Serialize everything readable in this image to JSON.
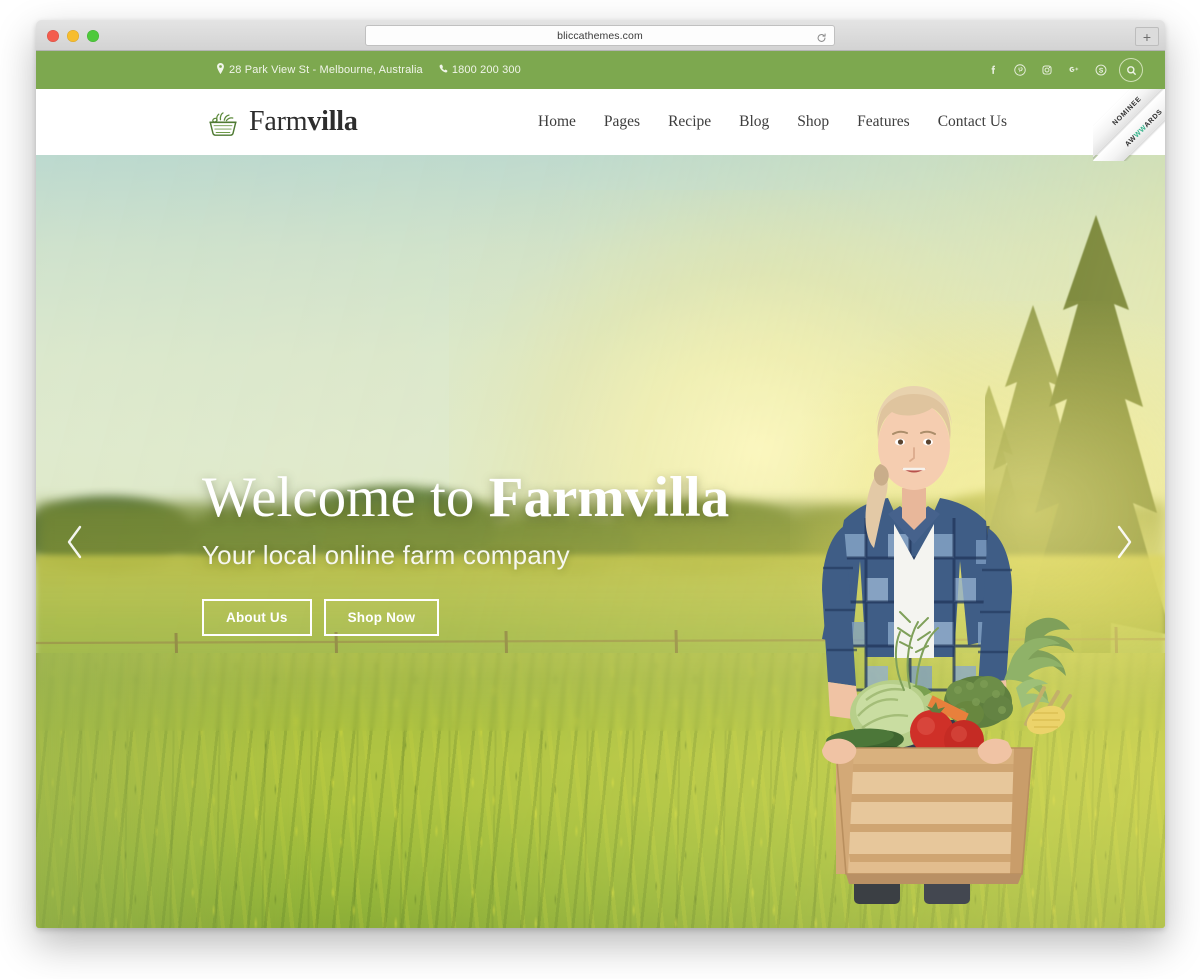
{
  "browser": {
    "url": "bliccathemes.com",
    "reload_icon": "reload-icon",
    "new_tab_label": "+",
    "traffic_lights": [
      "close",
      "minimize",
      "maximize"
    ]
  },
  "topbar": {
    "background": "#7da84f",
    "address": "28 Park View St - Melbourne, Australia",
    "phone": "1800 200 300",
    "address_icon": "map-pin-icon",
    "phone_icon": "phone-icon",
    "social": [
      {
        "name": "facebook-icon",
        "label": "f"
      },
      {
        "name": "pinterest-icon",
        "label": "P"
      },
      {
        "name": "instagram-icon",
        "label": "IG"
      },
      {
        "name": "google-plus-icon",
        "label": "G+"
      },
      {
        "name": "skype-icon",
        "label": "S"
      }
    ],
    "search_icon": "search-icon"
  },
  "header": {
    "logo": {
      "icon": "vegetable-basket-icon",
      "text_light": "Farm",
      "text_bold": "villa"
    },
    "nav": [
      {
        "label": "Home"
      },
      {
        "label": "Pages"
      },
      {
        "label": "Recipe"
      },
      {
        "label": "Blog"
      },
      {
        "label": "Shop"
      },
      {
        "label": "Features"
      },
      {
        "label": "Contact Us"
      }
    ]
  },
  "ribbon": {
    "line1": "NOMINEE",
    "line2_pre": "AW",
    "line2_mid": "WW",
    "line2_post": "ARDS"
  },
  "hero": {
    "title_light": "Welcome to ",
    "title_bold": "Farmvilla",
    "subtitle": "Your local online farm company",
    "buttons": [
      {
        "label": "About Us"
      },
      {
        "label": "Shop Now"
      }
    ],
    "prev_icon": "chevron-left-icon",
    "next_icon": "chevron-right-icon",
    "image_alt": "woman holding wooden crate of vegetables in a sunlit farm field"
  }
}
